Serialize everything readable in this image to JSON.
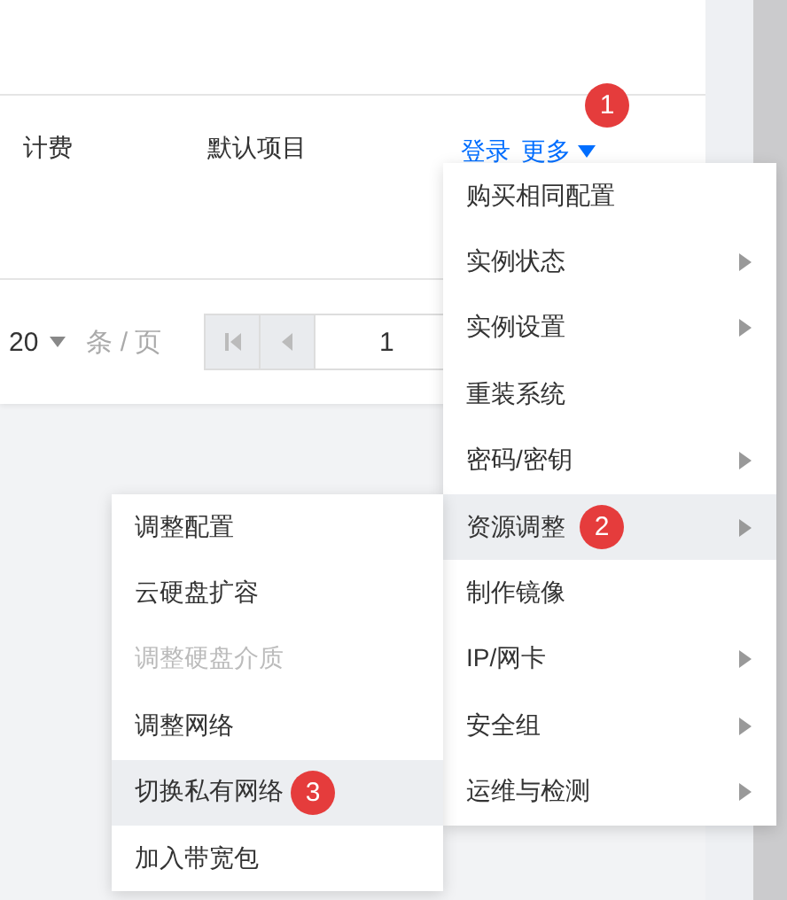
{
  "table": {
    "row": {
      "cells": [
        "计费",
        "默认项目"
      ],
      "actions": [
        {
          "label": "登录",
          "kind": "link"
        },
        {
          "label": "更多",
          "kind": "dropdown",
          "badge": "1"
        }
      ]
    }
  },
  "pagination": {
    "page_size": "20",
    "unit": "条 / 页",
    "page": "1"
  },
  "menu": {
    "items": [
      {
        "label": "购买相同配置",
        "has_submenu": false,
        "selected": false
      },
      {
        "label": "实例状态",
        "has_submenu": true,
        "selected": false
      },
      {
        "label": "实例设置",
        "has_submenu": true,
        "selected": false
      },
      {
        "label": "重装系统",
        "has_submenu": false,
        "selected": false
      },
      {
        "label": "密码/密钥",
        "has_submenu": true,
        "selected": false
      },
      {
        "label": "资源调整",
        "has_submenu": true,
        "selected": true,
        "badge": "2"
      },
      {
        "label": "制作镜像",
        "has_submenu": false,
        "selected": false
      },
      {
        "label": "IP/网卡",
        "has_submenu": true,
        "selected": false
      },
      {
        "label": "安全组",
        "has_submenu": true,
        "selected": false
      },
      {
        "label": "运维与检测",
        "has_submenu": true,
        "selected": false
      }
    ]
  },
  "submenu": {
    "items": [
      {
        "label": "调整配置",
        "disabled": false,
        "selected": false
      },
      {
        "label": "云硬盘扩容",
        "disabled": false,
        "selected": false
      },
      {
        "label": "调整硬盘介质",
        "disabled": true,
        "selected": false
      },
      {
        "label": "调整网络",
        "disabled": false,
        "selected": false
      },
      {
        "label": "切换私有网络",
        "disabled": false,
        "selected": true,
        "badge": "3"
      },
      {
        "label": "加入带宽包",
        "disabled": false,
        "selected": false
      }
    ]
  }
}
